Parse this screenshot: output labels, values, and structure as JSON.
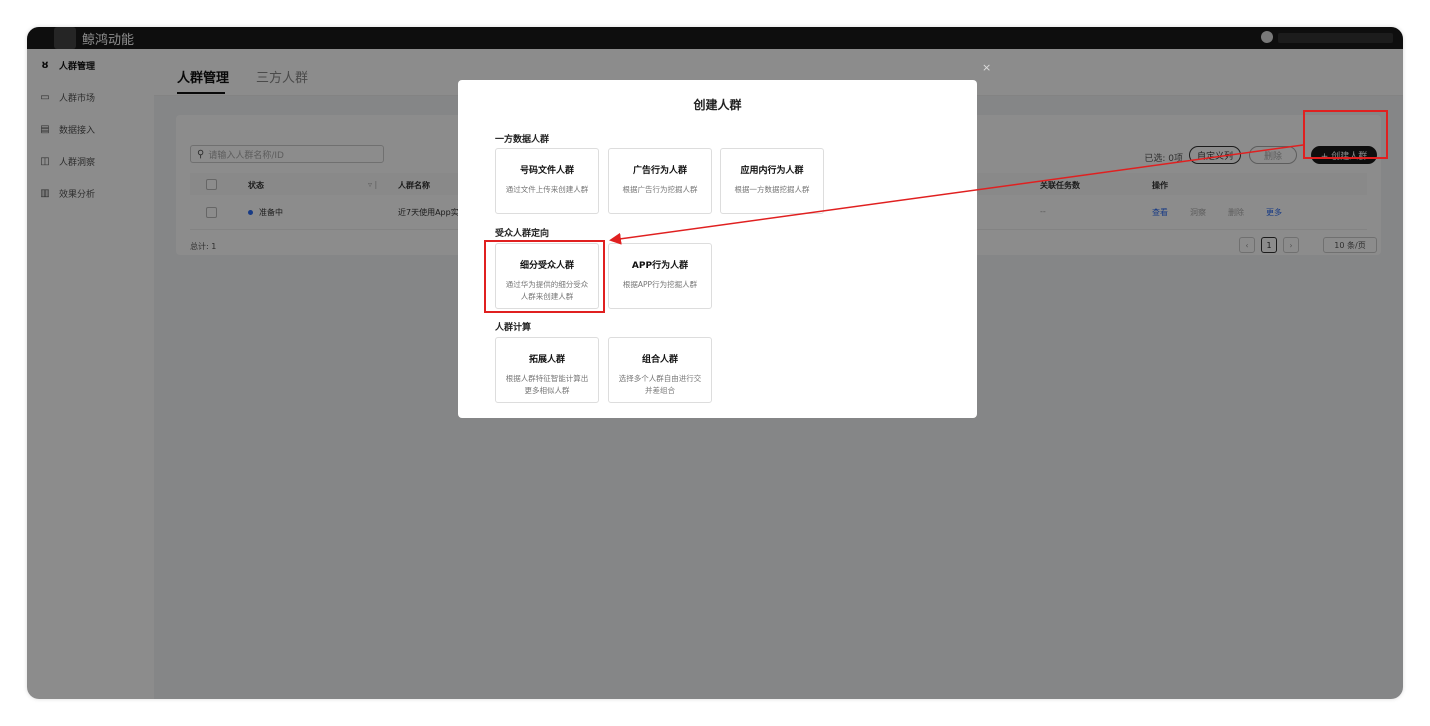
{
  "app": {
    "name": "鲸鸿动能"
  },
  "sidebar": {
    "items": [
      {
        "label": "人群管理",
        "icon": "user-icon",
        "active": true
      },
      {
        "label": "人群市场",
        "icon": "market-icon",
        "active": false
      },
      {
        "label": "数据接入",
        "icon": "database-icon",
        "active": false
      },
      {
        "label": "人群洞察",
        "icon": "insight-icon",
        "active": false
      },
      {
        "label": "效果分析",
        "icon": "analysis-icon",
        "active": false
      }
    ]
  },
  "tabs": [
    {
      "label": "人群管理"
    },
    {
      "label": "三方人群"
    }
  ],
  "toolbar": {
    "search_placeholder": "请输入人群名称/ID",
    "selected": "已选: 0项",
    "custom_columns": "自定义列",
    "delete": "删除",
    "create": "+ 创建人群"
  },
  "table": {
    "headers": [
      "状态",
      "人群名称",
      "关联任务数",
      "操作"
    ],
    "rows": [
      {
        "status": "准备中",
        "name": "近7天使用App实时人",
        "tasks": "--",
        "ops": [
          "查看",
          "洞察",
          "删除",
          "更多"
        ]
      }
    ],
    "total": "总计: 1",
    "page": "1",
    "page_size": "10 条/页"
  },
  "modal": {
    "title": "创建人群",
    "close": "×",
    "sections": [
      {
        "title": "一方数据人群",
        "options": [
          {
            "title": "号码文件人群",
            "desc": "通过文件上传来创建人群"
          },
          {
            "title": "广告行为人群",
            "desc": "根据广告行为挖掘人群"
          },
          {
            "title": "应用内行为人群",
            "desc": "根据一方数据挖掘人群"
          }
        ]
      },
      {
        "title": "受众人群定向",
        "options": [
          {
            "title": "细分受众人群",
            "desc": "通过华为提供的细分受众人群来创建人群"
          },
          {
            "title": "APP行为人群",
            "desc": "根据APP行为挖掘人群"
          }
        ]
      },
      {
        "title": "人群计算",
        "options": [
          {
            "title": "拓展人群",
            "desc": "根据人群特征智能计算出更多相似人群"
          },
          {
            "title": "组合人群",
            "desc": "选择多个人群自由进行交并差组合"
          }
        ]
      }
    ]
  },
  "colors": {
    "annotation": "#e02020",
    "accent": "#2a6bf2"
  }
}
